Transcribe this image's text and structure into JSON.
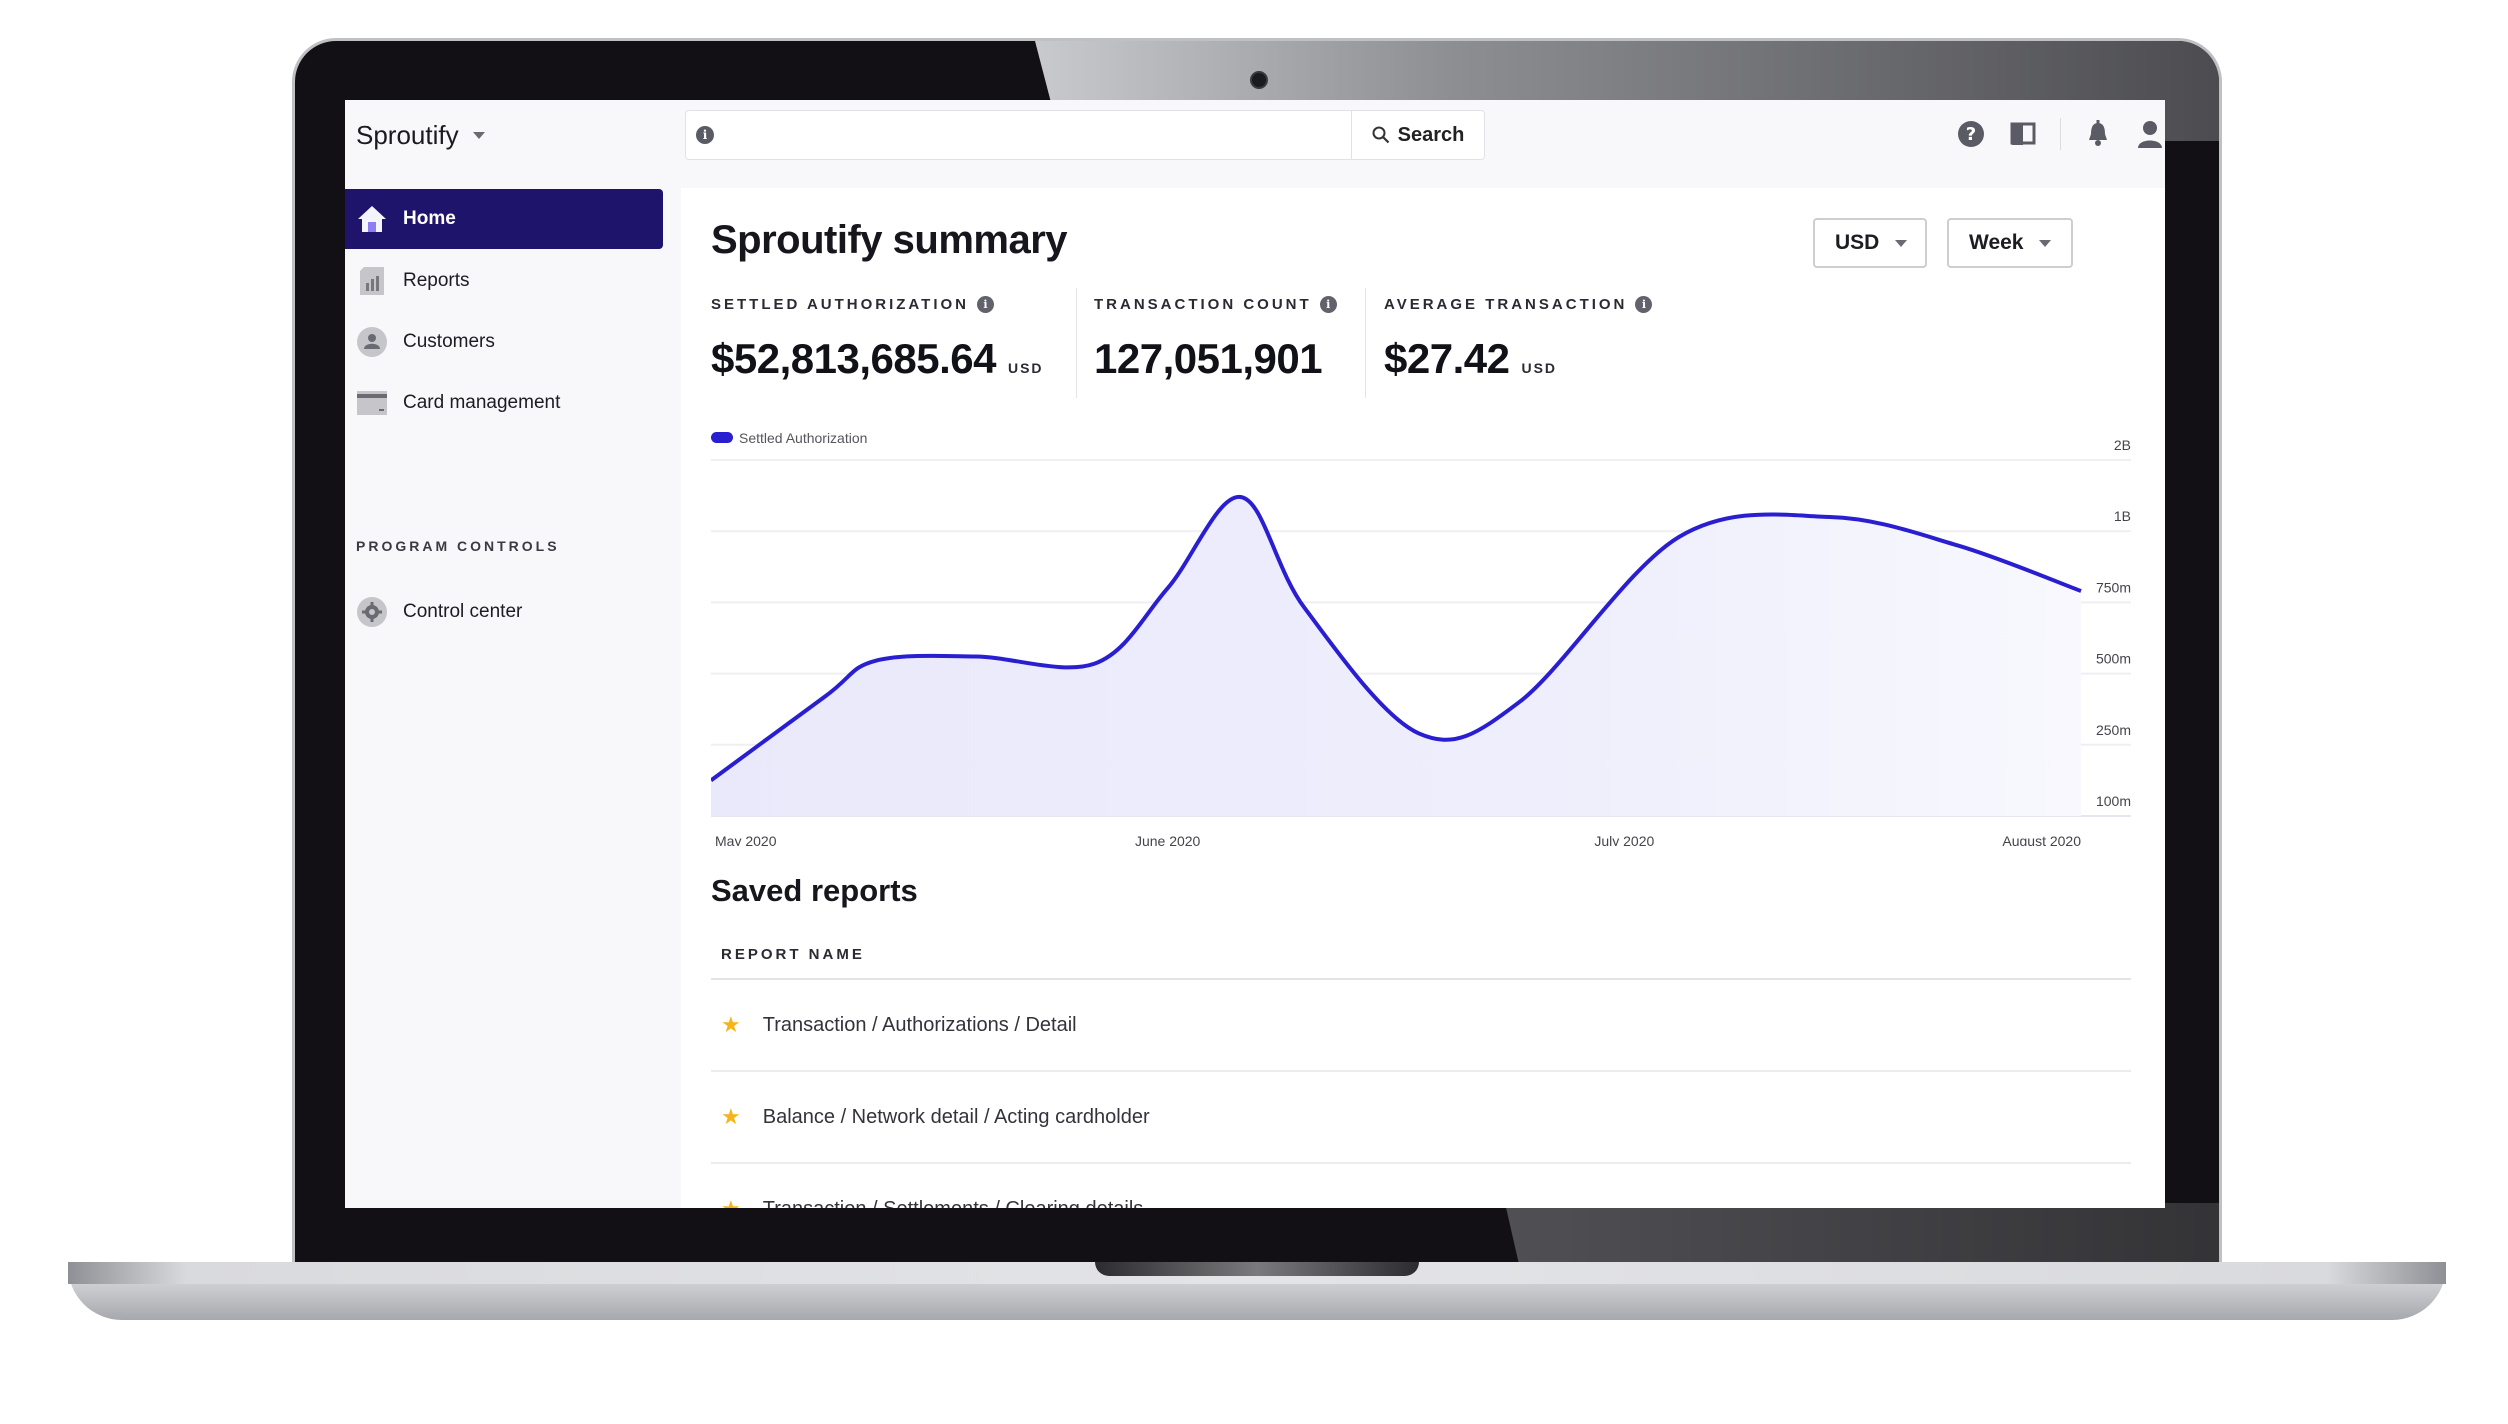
{
  "app": {
    "brand": "Sproutify",
    "search": {
      "placeholder": "",
      "value": "",
      "button_label": "Search"
    },
    "top_icons": [
      "help-icon",
      "book-icon",
      "bell-icon",
      "user-icon"
    ]
  },
  "sidebar": {
    "items": [
      {
        "label": "Home",
        "icon": "home-icon",
        "active": true
      },
      {
        "label": "Reports",
        "icon": "reports-icon",
        "active": false
      },
      {
        "label": "Customers",
        "icon": "customers-icon",
        "active": false
      },
      {
        "label": "Card management",
        "icon": "card-icon",
        "active": false
      }
    ],
    "section_label": "PROGRAM CONTROLS",
    "section_items": [
      {
        "label": "Control center",
        "icon": "gear-icon",
        "active": false
      }
    ]
  },
  "main": {
    "title": "Sproutify summary",
    "currency_dropdown": "USD",
    "period_dropdown": "Week",
    "metrics": [
      {
        "label": "SETTLED AUTHORIZATION",
        "value": "$52,813,685.64",
        "unit": "USD"
      },
      {
        "label": "TRANSACTION COUNT",
        "value": "127,051,901",
        "unit": ""
      },
      {
        "label": "AVERAGE TRANSACTION",
        "value": "$27.42",
        "unit": "USD"
      }
    ],
    "saved_reports": {
      "title": "Saved reports",
      "column_header": "REPORT NAME",
      "rows": [
        {
          "name": "Transaction / Authorizations / Detail",
          "starred": true
        },
        {
          "name": "Balance / Network detail / Acting cardholder",
          "starred": true
        },
        {
          "name": "Transaction / Settlements / Clearing details",
          "starred": true
        }
      ]
    }
  },
  "colors": {
    "accent": "#2a1fd0",
    "nav_active": "#1f146b",
    "fill": "#eeeefc",
    "star": "#f4b41a"
  },
  "chart_data": {
    "type": "area",
    "title": "",
    "legend": [
      {
        "name": "Settled Authorization",
        "color": "#2a1fd0"
      }
    ],
    "legend_position": "top-left",
    "x_ticks": [
      "May 2020",
      "June 2020",
      "July 2020",
      "August 2020"
    ],
    "y_ticks": [
      "2B",
      "1B",
      "750m",
      "500m",
      "250m",
      "100m"
    ],
    "y_tick_values": [
      2000000000,
      1000000000,
      750000000,
      500000000,
      250000000,
      100000000
    ],
    "y_axis_position": "right",
    "grid": true,
    "series": [
      {
        "name": "Settled Authorization",
        "x": [
          0,
          0.25,
          0.36,
          0.58,
          0.84,
          1.0,
          1.16,
          1.3,
          1.55,
          1.77,
          2.12,
          2.45,
          2.73,
          3.0
        ],
        "values": [
          175000000,
          420000000,
          545000000,
          560000000,
          535000000,
          800000000,
          1480000000,
          730000000,
          290000000,
          400000000,
          980000000,
          1200000000,
          950000000,
          790000000
        ]
      }
    ]
  }
}
